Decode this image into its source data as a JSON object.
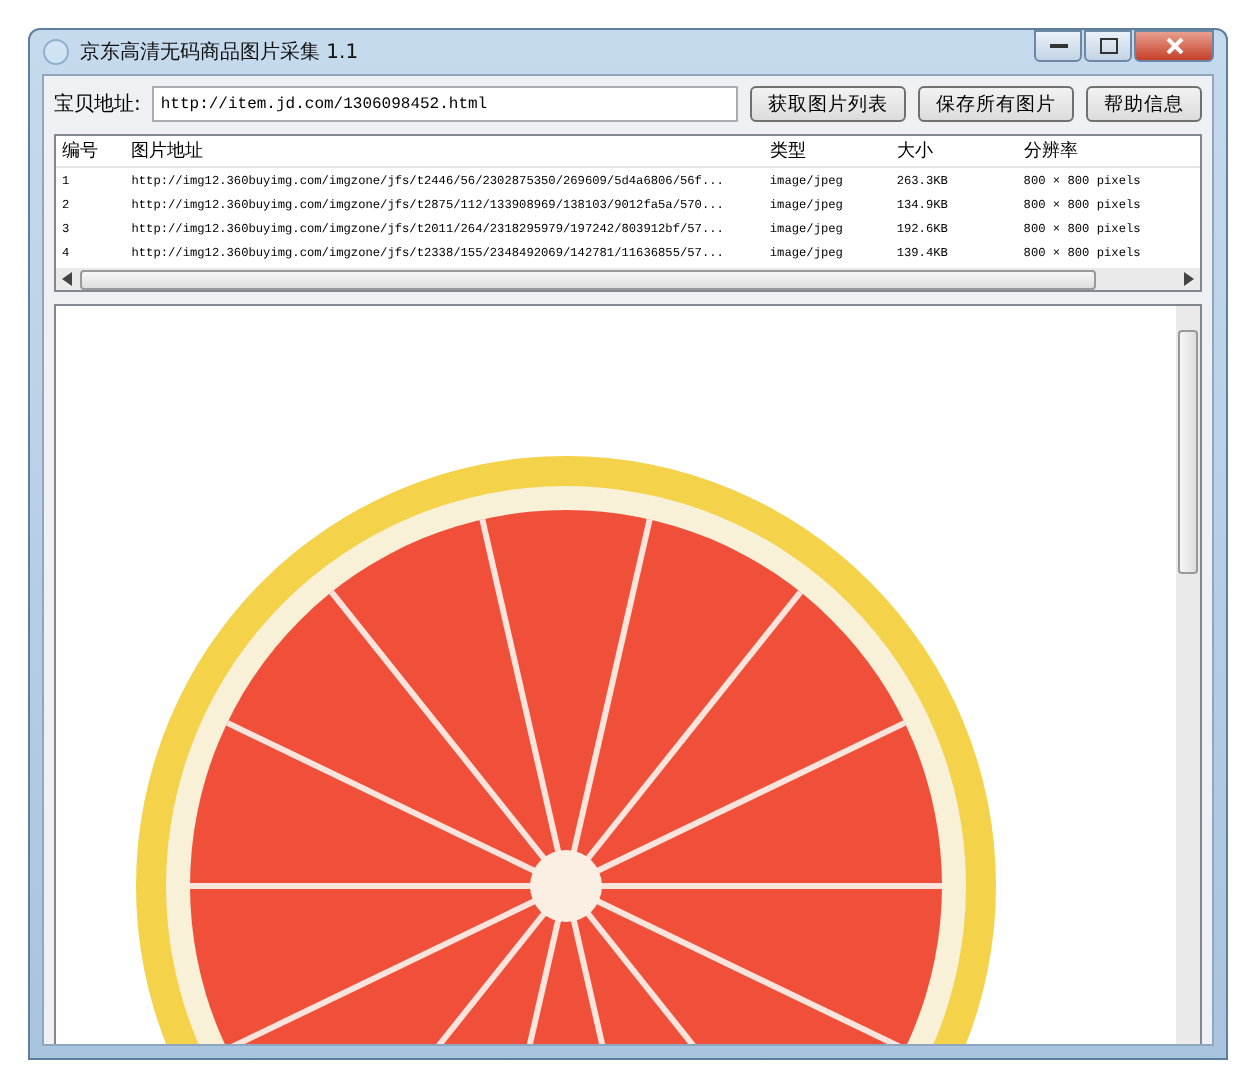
{
  "window": {
    "title": "京东高清无码商品图片采集 1.1"
  },
  "url_field": {
    "label": "宝贝地址:",
    "value": "http://item.jd.com/1306098452.html"
  },
  "buttons": [
    "获取图片列表",
    "保存所有图片",
    "帮助信息"
  ],
  "table": {
    "columns": [
      "编号",
      "图片地址",
      "类型",
      "大小",
      "分辨率"
    ],
    "rows": [
      [
        "1",
        "http://img12.360buyimg.com/imgzone/jfs/t2446/56/2302875350/269609/5d4a6806/56f...",
        "image/jpeg",
        "263.3KB",
        "800 × 800 pixels"
      ],
      [
        "2",
        "http://img12.360buyimg.com/imgzone/jfs/t2875/112/133908969/138103/9012fa5a/570...",
        "image/jpeg",
        "134.9KB",
        "800 × 800 pixels"
      ],
      [
        "3",
        "http://img12.360buyimg.com/imgzone/jfs/t2011/264/2318295979/197242/803912bf/57...",
        "image/jpeg",
        "192.6KB",
        "800 × 800 pixels"
      ],
      [
        "4",
        "http://img12.360buyimg.com/imgzone/jfs/t2338/155/2348492069/142781/11636855/57...",
        "image/jpeg",
        "139.4KB",
        "800 × 800 pixels"
      ]
    ]
  }
}
